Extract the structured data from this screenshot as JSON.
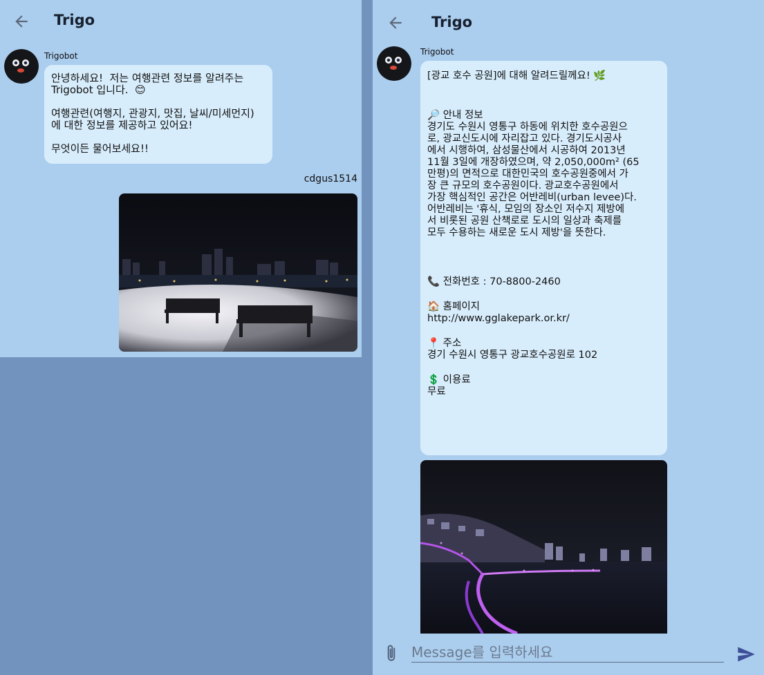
{
  "left": {
    "header": {
      "title": "Trigo"
    },
    "bot_message": {
      "sender": "Trigobot",
      "text": "안녕하세요!  저는 여행관련 정보를 알려주는\nTrigobot 입니다.  😊\n\n여행관련(여행지, 관광지, 맛집, 날씨/미세먼지)\n에 대한 정보를 제공하고 있어요!\n\n무엇이든 물어보세요!!"
    },
    "user_message": {
      "username": "cdgus1514"
    }
  },
  "right": {
    "header": {
      "title": "Trigo"
    },
    "bot_message": {
      "sender": "Trigobot",
      "heading": "[광교 호수 공원]에 대해 알려드릴께요! 🌿",
      "info_label": "🔎 안내 정보",
      "info_text": "경기도 수원시 영통구 하동에 위치한 호수공원으\n로, 광교신도시에 자리잡고 있다. 경기도시공사\n에서 시행하여, 삼성물산에서 시공하여 2013년\n11월 3일에 개장하였으며, 약 2,050,000m² (65\n만평)의 면적으로 대한민국의 호수공원중에서 가\n장 큰 규모의 호수공원이다. 광교호수공원에서\n가장 핵심적인 공간은 어반레비(urban levee)다.\n어반레비는 '휴식, 모임의 장소인 저수지 제방에\n서 비롯된 공원 산책로로 도시의 일상과 축제를\n모두 수용하는 새로운 도시 제방'을 뜻한다.",
      "phone": "📞 전화번호 : 70-8800-2460",
      "homepage_label": "🏠 홈페이지",
      "homepage_url": "http://www.gglakepark.or.kr/",
      "address_label": "📍 주소",
      "address": "경기 수원시 영통구 광교호수공원로 102",
      "fee_label": "💲 이용료",
      "fee": "무료"
    },
    "input": {
      "placeholder": "Message를 입력하세요"
    }
  },
  "colors": {
    "app_background": "#abcdee",
    "outer_background": "#7393bf",
    "bubble": "#d8edfc",
    "send_icon": "#3d4f97"
  },
  "icons": [
    "back-arrow-icon",
    "paperclip-icon",
    "send-icon"
  ]
}
